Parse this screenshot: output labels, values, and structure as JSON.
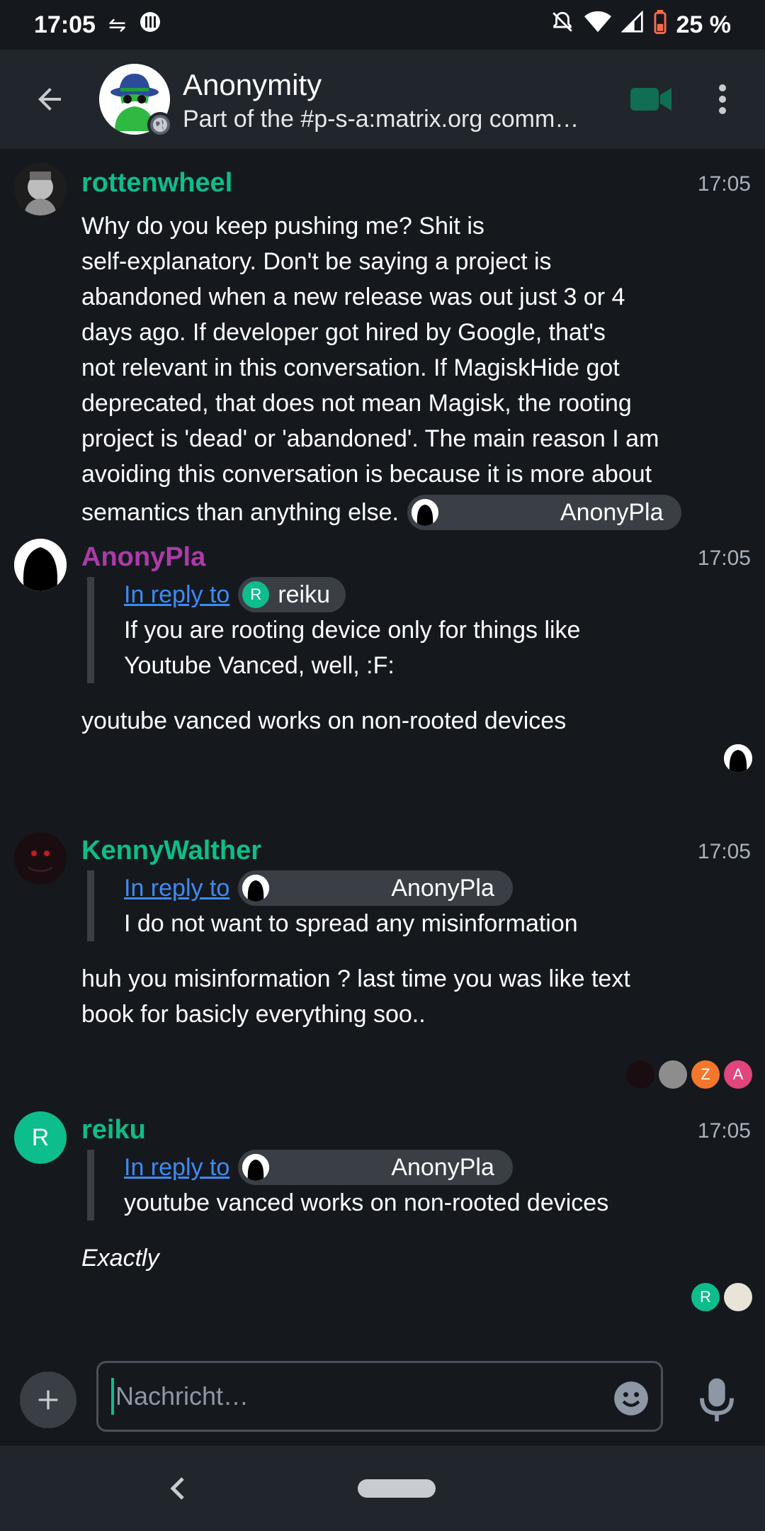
{
  "status_bar": {
    "time": "17:05",
    "battery": "25 %"
  },
  "header": {
    "room_name": "Anonymity",
    "topic": "Part of the #p-s-a:matrix.org comm…"
  },
  "messages": [
    {
      "sender": "rottenwheel",
      "sender_color": "#0dbd8b",
      "time": "17:05",
      "lines": [
        "Why do you keep pushing me? Shit is",
        "self-explanatory. Don't be saying a project is",
        "abandoned when a new release was out just 3 or 4",
        "days ago. If developer got hired by Google, that's",
        "not relevant in this conversation. If MagiskHide got",
        "deprecated, that does not mean Magisk, the rooting",
        "project is 'dead' or 'abandoned'. The main reason I am",
        "avoiding this conversation is because it is more about",
        "semantics than anything else."
      ],
      "mention": "AnonyPla"
    },
    {
      "sender": "AnonyPla",
      "sender_color": "#ac3ba8",
      "time": "17:05",
      "reply_label": "In reply to",
      "reply_to": "reiku",
      "reply_avatar_letter": "R",
      "quoted": [
        "If you are rooting device only for things like",
        "Youtube Vanced, well, :F:"
      ],
      "body": "youtube vanced works on non-rooted devices"
    },
    {
      "sender": "KennyWalther",
      "sender_color": "#0dbd8b",
      "time": "17:05",
      "reply_label": "In reply to",
      "reply_to": "AnonyPla",
      "quoted": [
        "I do not want to spread any misinformation"
      ],
      "body_lines": [
        "huh you misinformation ? last time you was like text",
        "book for basicly everything soo.."
      ],
      "receipts": [
        "Z",
        "A"
      ]
    },
    {
      "sender": "reiku",
      "sender_color": "#0dbd8b",
      "avatar_letter": "R",
      "time": "17:05",
      "reply_label": "In reply to",
      "reply_to": "AnonyPla",
      "quoted": [
        "youtube vanced works on non-rooted devices"
      ],
      "body": "Exactly",
      "receipts": [
        "R"
      ]
    }
  ],
  "composer": {
    "placeholder": "Nachricht…"
  },
  "colors": {
    "accent": "#0dbd8b",
    "background": "#15191e",
    "header": "#21262c",
    "link": "#3d8bf4"
  }
}
